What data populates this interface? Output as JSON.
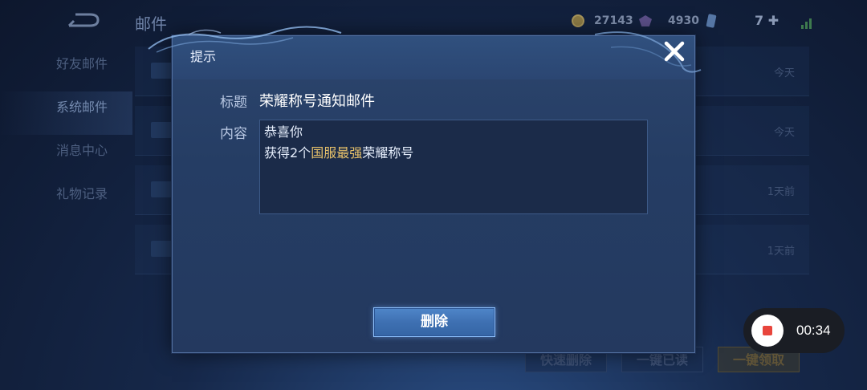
{
  "header": {
    "page_title": "邮件",
    "coins": "27143",
    "gems": "4930",
    "energy": "7"
  },
  "sidebar": {
    "items": [
      {
        "label": "好友邮件"
      },
      {
        "label": "系统邮件"
      },
      {
        "label": "消息中心"
      },
      {
        "label": "礼物记录"
      }
    ]
  },
  "mail_list": {
    "dates": [
      "今天",
      "今天",
      "1天前",
      "1天前"
    ]
  },
  "bottom_actions": {
    "quick_delete": "快速删除",
    "mark_all_read": "一键已读",
    "claim_all": "一键领取"
  },
  "dialog": {
    "title": "提示",
    "subject_label": "标题",
    "subject_value": "荣耀称号通知邮件",
    "content_label": "内容",
    "content_line1": "恭喜你",
    "content_line2_prefix": "获得2个",
    "content_line2_highlight": "国服最强",
    "content_line2_suffix": "荣耀称号",
    "delete_label": "删除"
  },
  "recorder": {
    "time": "00:34"
  },
  "colors": {
    "highlight": "#e7c16a",
    "record_red": "#e8453c"
  }
}
